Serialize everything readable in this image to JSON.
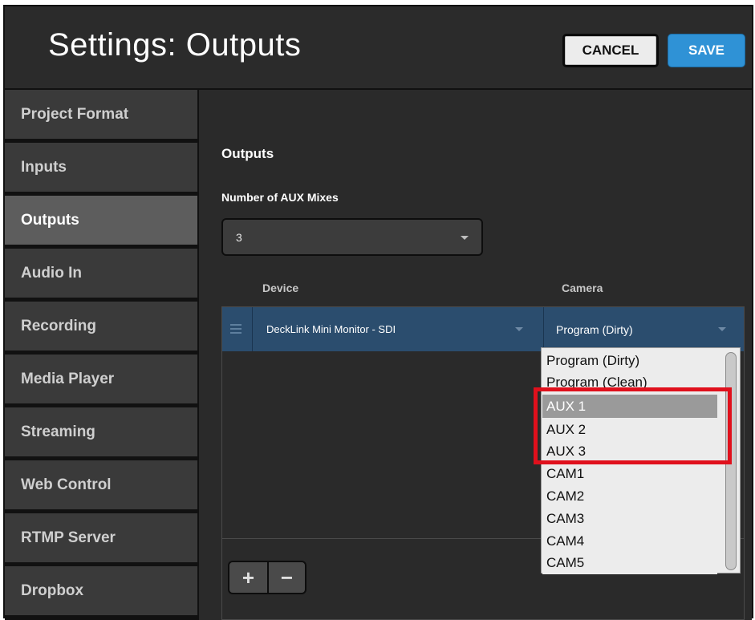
{
  "window": {
    "title": "Settings: Outputs"
  },
  "header": {
    "cancel_label": "CANCEL",
    "save_label": "SAVE"
  },
  "sidebar": {
    "items": [
      {
        "label": "Project Format",
        "active": false
      },
      {
        "label": "Inputs",
        "active": false
      },
      {
        "label": "Outputs",
        "active": true
      },
      {
        "label": "Audio In",
        "active": false
      },
      {
        "label": "Recording",
        "active": false
      },
      {
        "label": "Media Player",
        "active": false
      },
      {
        "label": "Streaming",
        "active": false
      },
      {
        "label": "Web Control",
        "active": false
      },
      {
        "label": "RTMP Server",
        "active": false
      },
      {
        "label": "Dropbox",
        "active": false
      }
    ]
  },
  "main": {
    "section_title": "Outputs",
    "aux_label": "Number of AUX Mixes",
    "aux_value": "3",
    "columns": {
      "device": "Device",
      "camera": "Camera"
    },
    "rows": [
      {
        "device": "DeckLink Mini Monitor - SDI",
        "camera": "Program (Dirty)"
      }
    ],
    "add_label": "+",
    "remove_label": "−"
  },
  "camera_dropdown": {
    "options": [
      "Program (Dirty)",
      "Program (Clean)",
      "AUX 1",
      "AUX 2",
      "AUX 3",
      "CAM1",
      "CAM2",
      "CAM3",
      "CAM4",
      "CAM5"
    ],
    "highlighted": "AUX 1"
  },
  "colors": {
    "accent": "#2f92d6",
    "row_selected": "#2b4d6e",
    "annotation": "#e0101c"
  }
}
